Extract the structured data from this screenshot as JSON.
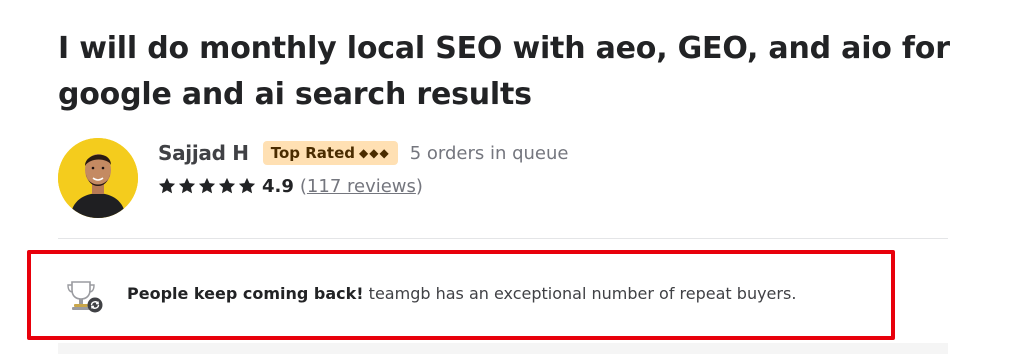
{
  "gig": {
    "title": "I will do monthly local SEO with aeo, GEO, and aio for google and ai search results"
  },
  "seller": {
    "name": "Sajjad H",
    "badge_label": "Top Rated",
    "badge_diamonds": "◆◆◆",
    "queue": "5 orders in queue",
    "rating": "4.9",
    "reviews_open": "(",
    "reviews_link": "117 reviews",
    "reviews_close": ")",
    "star_count": 5,
    "avatar_icon": "seller-avatar",
    "star_icon": "star-icon"
  },
  "repeat_notice": {
    "bold": "People keep coming back!",
    "text": " teamgb has an exceptional number of repeat buyers.",
    "icon": "trophy-repeat-icon"
  },
  "colors": {
    "highlight_border": "#e8000b",
    "badge_bg": "#ffe0b3",
    "avatar_bg": "#f4cc1d"
  }
}
